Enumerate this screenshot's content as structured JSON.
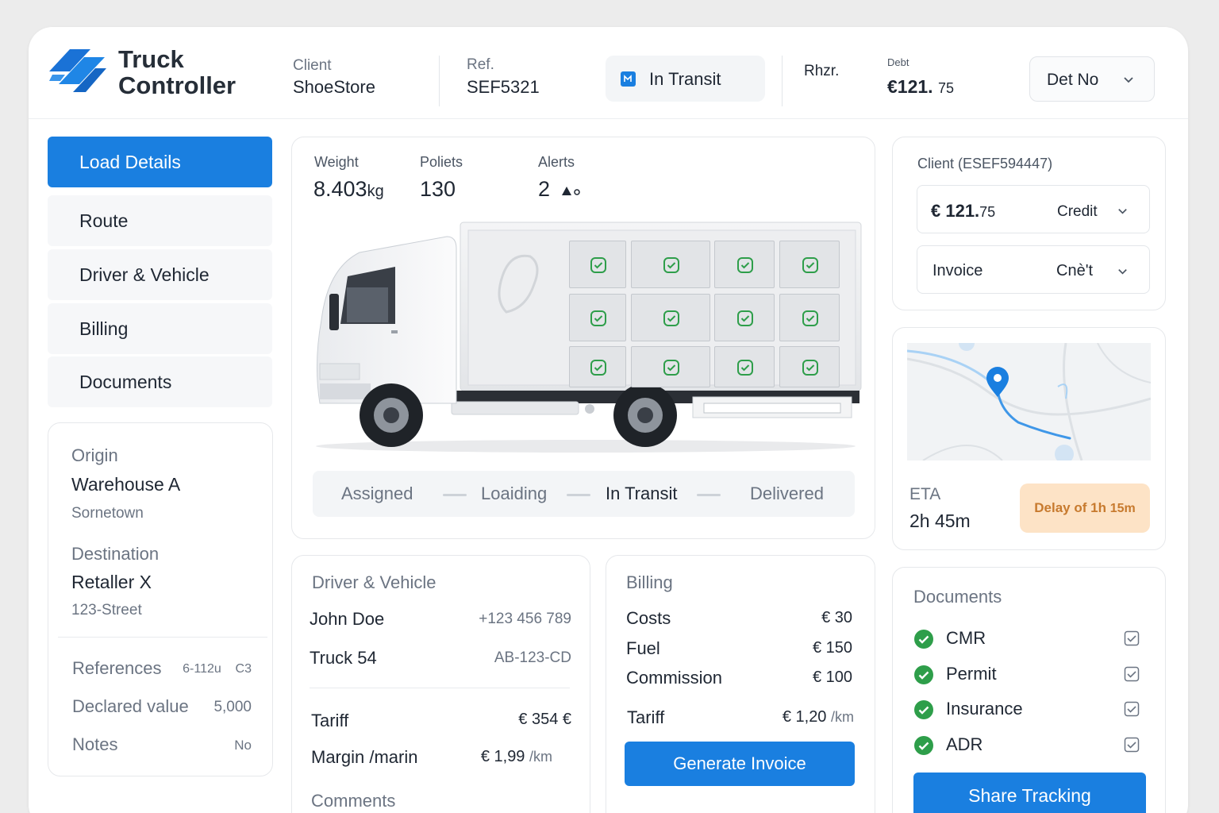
{
  "header": {
    "brand_line1": "Truck",
    "brand_line2": "Controller",
    "client_label": "Client",
    "client_value": "ShoeStore",
    "ref_label": "Ref.",
    "ref_value": "SEF5321",
    "status": "In Transit",
    "rhzr": "Rhzr.",
    "debt_label": "Debt",
    "debt_value_main": "€121.",
    "debt_value_cents": "75",
    "det_select": "Det No"
  },
  "nav": [
    {
      "label": "Load Details",
      "active": true
    },
    {
      "label": "Route",
      "active": false
    },
    {
      "label": "Driver & Vehicle",
      "active": false
    },
    {
      "label": "Billing",
      "active": false
    },
    {
      "label": "Documents",
      "active": false
    }
  ],
  "route": {
    "origin_label": "Origin",
    "origin_name": "Warehouse A",
    "origin_city": "Sornetown",
    "dest_label": "Destination",
    "dest_name": "Retaller X",
    "dest_street": "123-Street",
    "references_label": "References",
    "references_value": "6-112u    C3",
    "declared_label": "Declared value",
    "declared_value": "5,000",
    "notes_label": "Notes",
    "notes_value": "No"
  },
  "load": {
    "weight_label": "Weight",
    "weight_value": "8.403",
    "weight_unit": "kg",
    "pallets_label": "Poliets",
    "pallets_value": "130",
    "alerts_label": "Alerts",
    "alerts_value": "2",
    "pallet_checks_total": 12,
    "steps": [
      "Assigned",
      "Loaiding",
      "In Transit",
      "Delivered"
    ],
    "current_step": "In Transit"
  },
  "driver": {
    "title": "Driver & Vehicle",
    "name": "John Doe",
    "phone": "+123 456 789",
    "truck": "Truck 54",
    "plate": "AB-123-CD",
    "tariff_label": "Tariff",
    "tariff_value": "€ 354 €",
    "margin_label": "Margin /marin",
    "margin_value": "€ 1,99",
    "margin_unit": "/km",
    "comments_label": "Comments"
  },
  "billing": {
    "title": "Billing",
    "costs_label": "Costs",
    "costs_value": "€ 30",
    "fuel_label": "Fuel",
    "fuel_value": "€ 150",
    "commission_label": "Commission",
    "commission_value": "€ 100",
    "tariff_label": "Tariff",
    "tariff_value": "€ 1,20",
    "tariff_unit": "/km",
    "generate_button": "Generate Invoice"
  },
  "client_panel": {
    "title": "Client (ESEF594447)",
    "amount_main": "€ 121.",
    "amount_cents": "75",
    "amount_type": "Credit",
    "invoice_label": "Invoice",
    "invoice_value": "Cnè't"
  },
  "eta": {
    "label": "ETA",
    "value": "2h 45m",
    "delay_text": "Delay of 1h",
    "delay_small": "15m"
  },
  "documents": {
    "title": "Documents",
    "items": [
      "CMR",
      "Permit",
      "Insurance",
      "ADR"
    ],
    "share_button": "Share Tracking"
  },
  "colors": {
    "accent": "#1a7fe0",
    "check_green": "#2e9e4a",
    "delay_bg": "#fde3c6",
    "delay_text": "#c77a2e"
  }
}
